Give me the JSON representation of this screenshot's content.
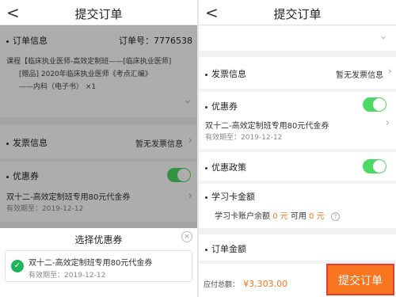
{
  "left": {
    "nav": {
      "back": "<",
      "title": "提交订单"
    },
    "order_info": {
      "label": "订单信息",
      "order_no": "订单号：7776538",
      "course_line1": "课程【临床执业医师-高效定制班——[临床执业医师]",
      "course_line2": "[赠品] 2020年临床执业医师《考点汇编》",
      "course_line3": "——内科（电子书）  ×1"
    },
    "invoice": {
      "label": "发票信息",
      "value": "暂无发票信息"
    },
    "coupon": {
      "label": "优惠券",
      "name": "双十二-高效定制班专用80元代金券",
      "expiry": "有效期至：2019-12-12"
    },
    "sheet": {
      "title": "选择优惠券",
      "close": "×",
      "coupon_name": "双十二-高效定制班专用80元代金券",
      "coupon_expiry": "有效期至：2019-12-12"
    }
  },
  "right": {
    "nav": {
      "back": "<",
      "title": "提交订单"
    },
    "invoice": {
      "label": "发票信息",
      "value": "暂无发票信息"
    },
    "coupon": {
      "label": "优惠券",
      "name": "双十二-高效定制班专用80元代金券",
      "expiry": "有效期至：2019-12-12"
    },
    "policy": {
      "label": "优惠政策"
    },
    "card": {
      "label": "学习卡金额",
      "balance_prefix": "学习卡账户余额",
      "balance": "0 元",
      "usable_prefix": "可用",
      "usable": "0 元"
    },
    "order_amount": {
      "label": "订单金额"
    },
    "total": {
      "label": "应付总额：",
      "amount": "¥3,303.00"
    },
    "submit": "提交订单"
  },
  "colors": {
    "accent": "#f7761f",
    "toggle": "#4cd964",
    "check": "#1fb35a",
    "highlight": "#e53b2c"
  }
}
